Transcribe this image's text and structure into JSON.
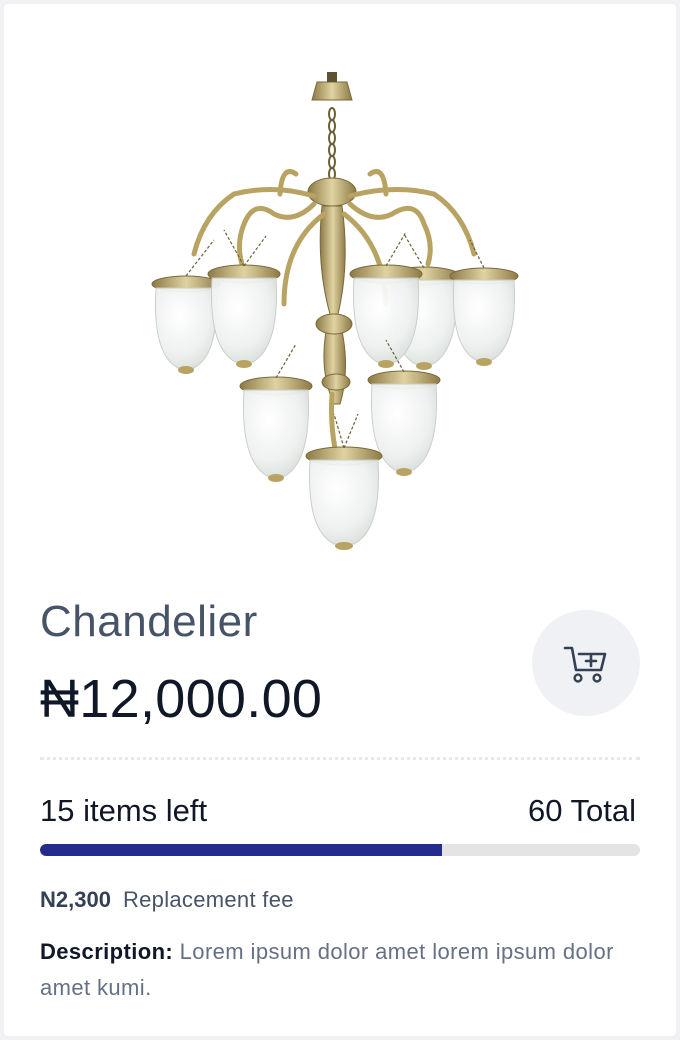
{
  "product": {
    "name": "Chandelier",
    "price": "₦12,000.00",
    "image_alt": "Brass chandelier with glass bell shades"
  },
  "stock": {
    "left_label": "15 items left",
    "total_label": "60 Total",
    "progress_fraction": 0.67
  },
  "fee": {
    "amount": "N2,300",
    "label": "Replacement fee"
  },
  "description": {
    "label": "Description:",
    "text": " Lorem ipsum dolor amet lorem ipsum dolor amet kumi."
  },
  "colors": {
    "progress_fill": "#232c8b",
    "progress_track": "#e4e4e7",
    "cart_button_bg": "#eff1f5",
    "brass": "#b9a363"
  },
  "icons": {
    "cart": "add-to-cart-icon"
  }
}
